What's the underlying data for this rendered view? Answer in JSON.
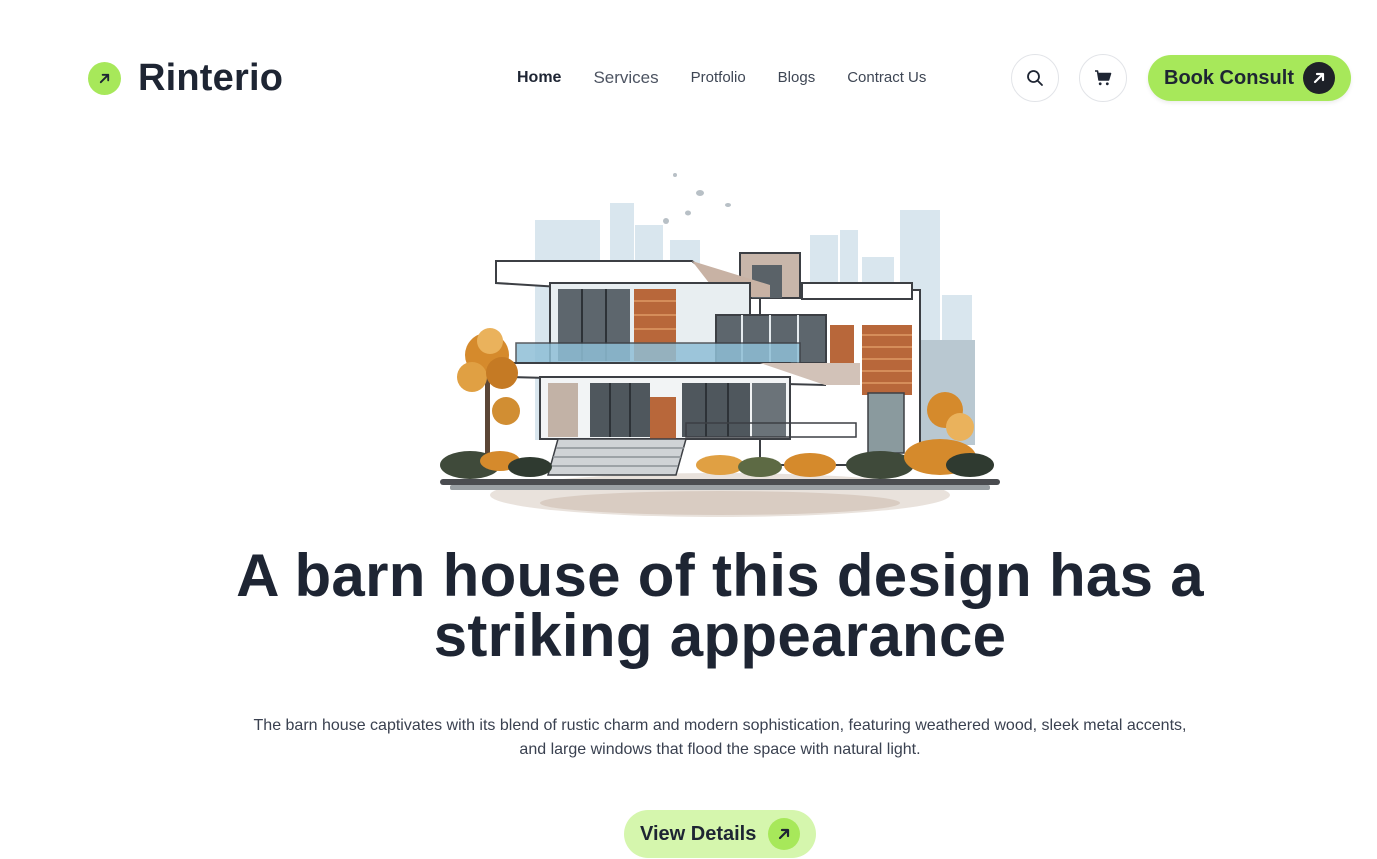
{
  "brand": {
    "name": "Rinterio",
    "mark_icon": "arrow-up-right-icon",
    "accent_color": "#a7e85a"
  },
  "nav": {
    "items": [
      {
        "label": "Home",
        "active": true
      },
      {
        "label": "Services",
        "active": false
      },
      {
        "label": "Protfolio",
        "active": false
      },
      {
        "label": "Blogs",
        "active": false
      },
      {
        "label": "Contract Us",
        "active": false
      }
    ]
  },
  "header_actions": {
    "search_icon": "search-icon",
    "cart_icon": "cart-icon",
    "cta_label": "Book Consult",
    "cta_icon": "arrow-up-right-icon"
  },
  "hero": {
    "image": "modern-house-illustration",
    "headline": "A barn house of this design has a striking appearance",
    "description": "The barn house captivates with its blend of rustic charm and modern sophistication, featuring weathered wood, sleek metal accents, and large windows that flood the space with natural light.",
    "button_label": "View Details",
    "button_icon": "arrow-up-right-icon"
  },
  "colors": {
    "text_dark": "#1e2533",
    "accent": "#a7e85a",
    "accent_soft": "#d5f6ad"
  }
}
